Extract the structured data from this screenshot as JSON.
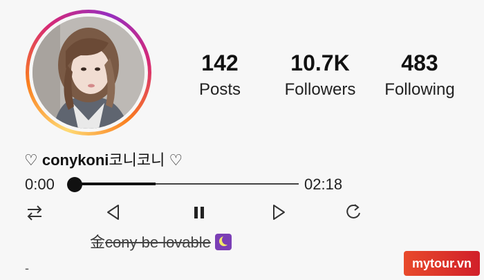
{
  "profile": {
    "stats": [
      {
        "value": "142",
        "label": "Posts"
      },
      {
        "value": "10.7K",
        "label": "Followers"
      },
      {
        "value": "483",
        "label": "Following"
      }
    ],
    "display_name": {
      "prefix": "♡ ",
      "name": "conykoni",
      "suffix": "코니코니 ♡"
    }
  },
  "player": {
    "current_time": "0:00",
    "total_time": "02:18",
    "progress": 0.0,
    "controls": [
      "shuffle-icon",
      "previous-icon",
      "pause-icon",
      "next-icon",
      "repeat-icon"
    ]
  },
  "bio": {
    "char": "金",
    "struck_text": "cony be lovable",
    "emoji": "crescent-moon-icon",
    "extra_line": "-"
  },
  "watermark": {
    "text": "mytour.vn"
  },
  "colors": {
    "ring_start": "#feda75",
    "ring_mid": "#d62976",
    "ring_end": "#962fbf",
    "watermark": "#d11f2a"
  }
}
